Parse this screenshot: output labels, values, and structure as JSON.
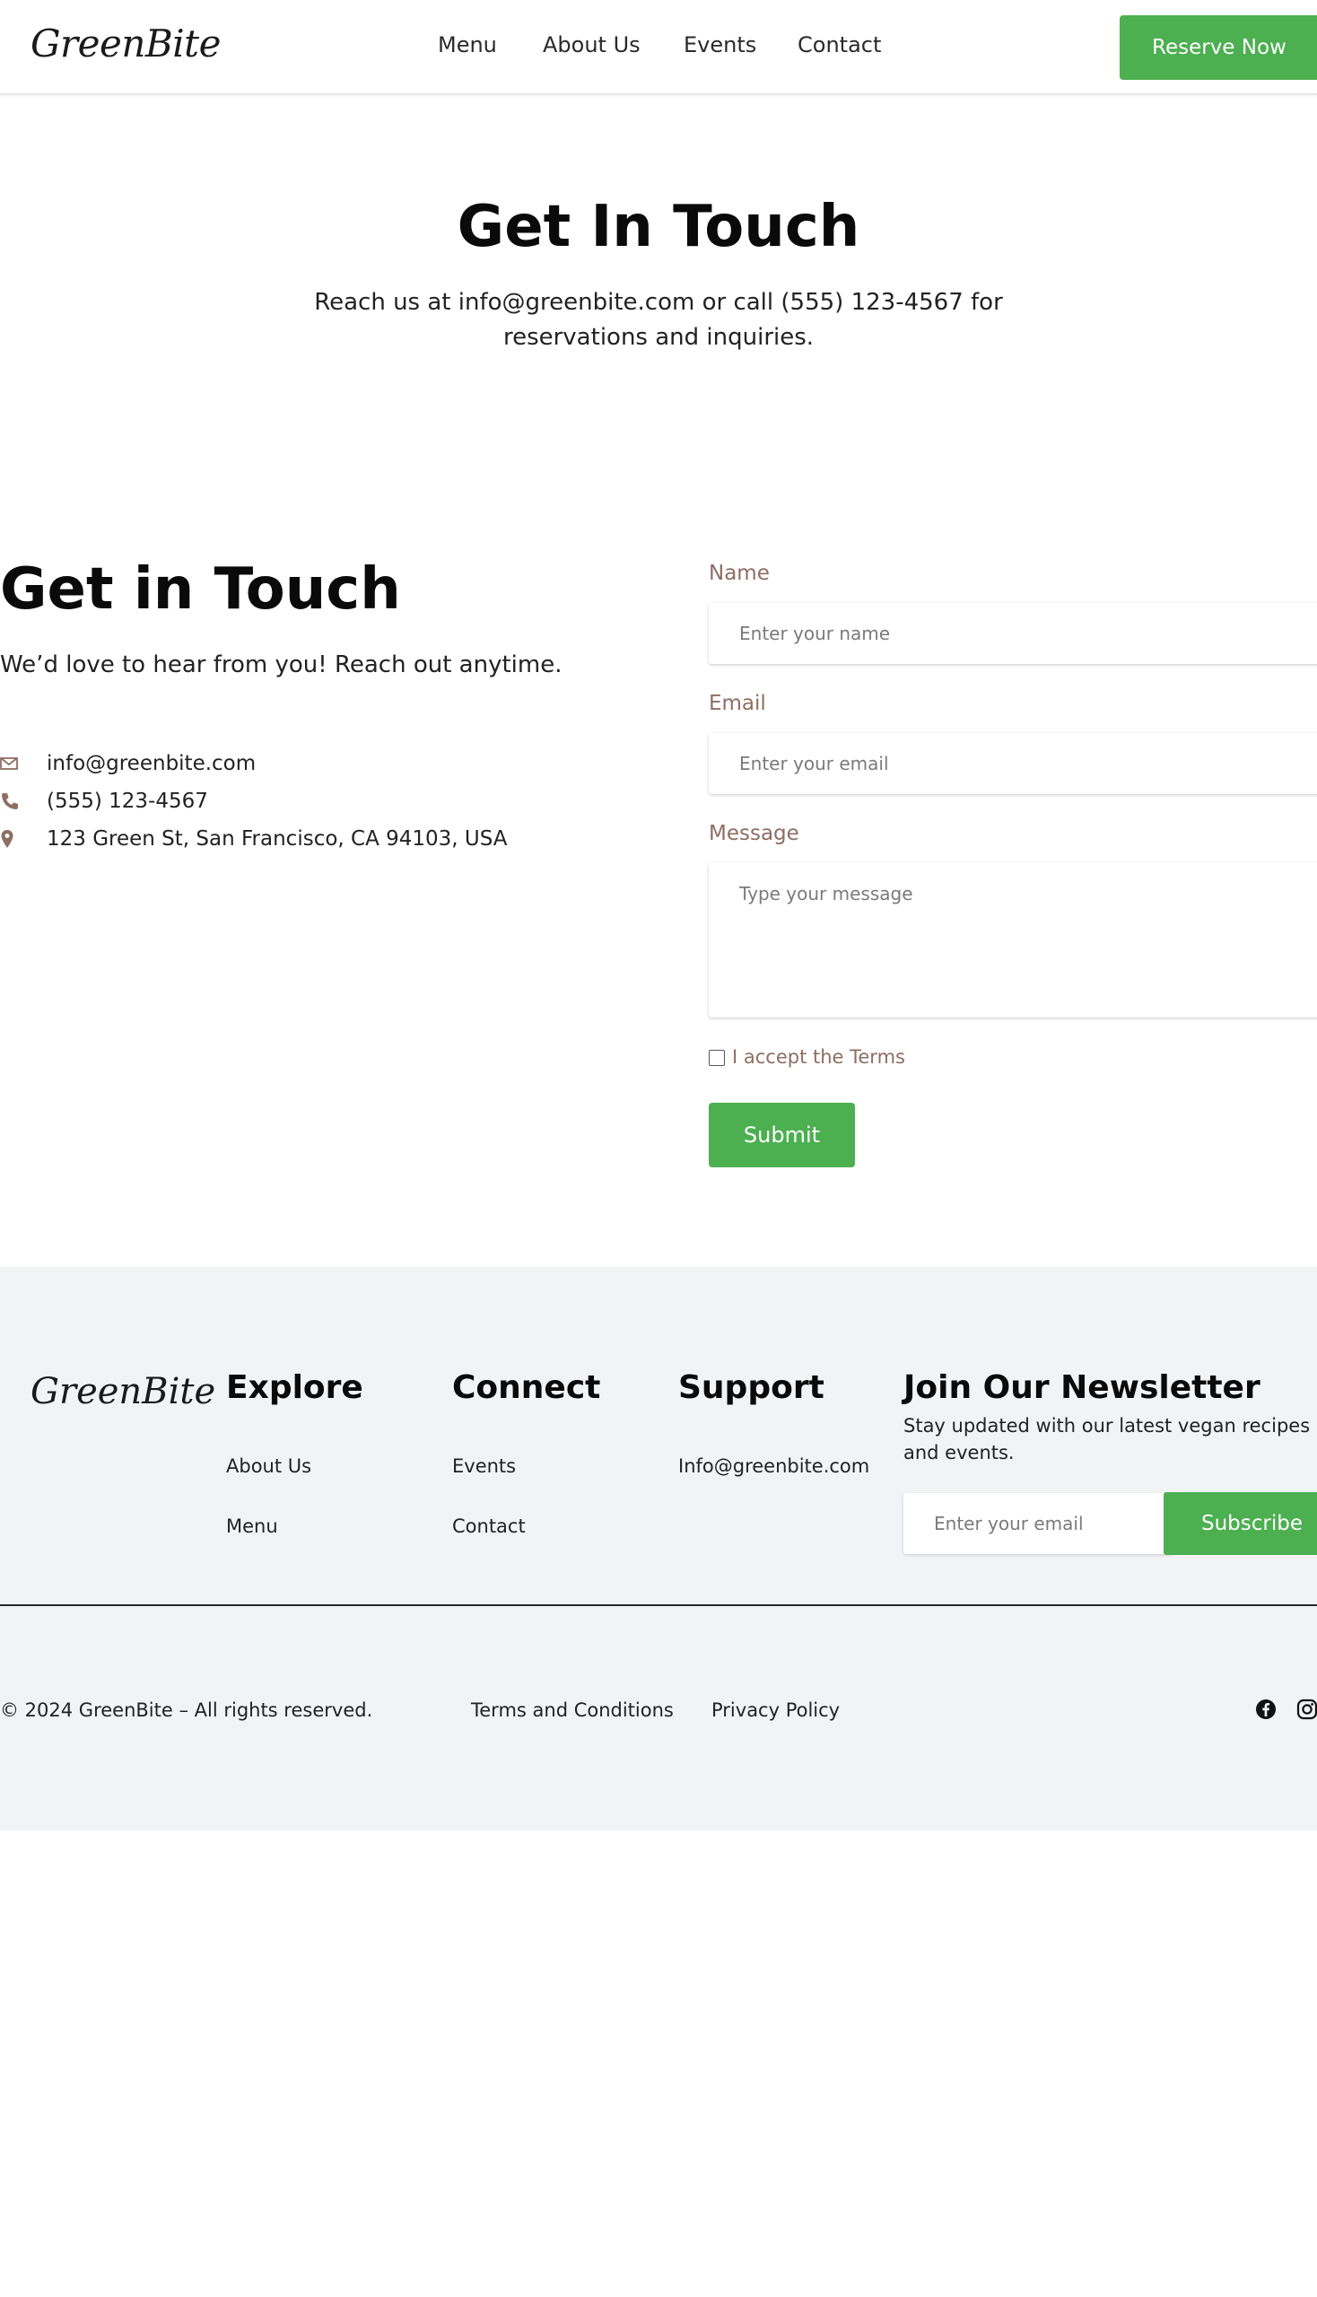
{
  "header": {
    "logo": "GreenBite",
    "nav": [
      {
        "label": "Menu"
      },
      {
        "label": "About Us"
      },
      {
        "label": "Events"
      },
      {
        "label": "Contact"
      }
    ],
    "reserve_label": "Reserve Now"
  },
  "hero": {
    "title": "Get In Touch",
    "subtitle": "Reach us at info@greenbite.com or call (555) 123-4567 for reservations and inquiries."
  },
  "contact": {
    "title": "Get in Touch",
    "subtitle": "We’d love to hear from you! Reach out anytime.",
    "email": "info@greenbite.com",
    "phone": "(555) 123-4567",
    "address": "123 Green St, San Francisco, CA 94103, USA"
  },
  "form": {
    "name_label": "Name",
    "name_placeholder": "Enter your name",
    "email_label": "Email",
    "email_placeholder": "Enter your email",
    "message_label": "Message",
    "message_placeholder": "Type your message",
    "terms_label": "I accept the Terms",
    "submit_label": "Submit"
  },
  "footer": {
    "logo": "GreenBite",
    "explore": {
      "title": "Explore",
      "links": [
        "About Us",
        "Menu"
      ]
    },
    "connect": {
      "title": "Connect",
      "links": [
        "Events",
        "Contact"
      ]
    },
    "support": {
      "title": "Support",
      "links": [
        "Info@greenbite.com"
      ]
    },
    "newsletter": {
      "title": "Join Our Newsletter",
      "subtitle": "Stay updated with our latest vegan recipes and events.",
      "placeholder": "Enter your email",
      "subscribe_label": "Subscribe"
    },
    "copyright": "© 2024 GreenBite – All rights reserved.",
    "terms": "Terms and Conditions",
    "privacy": "Privacy Policy",
    "social": [
      "facebook-icon",
      "instagram-icon"
    ]
  },
  "colors": {
    "accent": "#4caf50",
    "label": "#8d6e63",
    "footer_bg": "#f2f3f5"
  }
}
